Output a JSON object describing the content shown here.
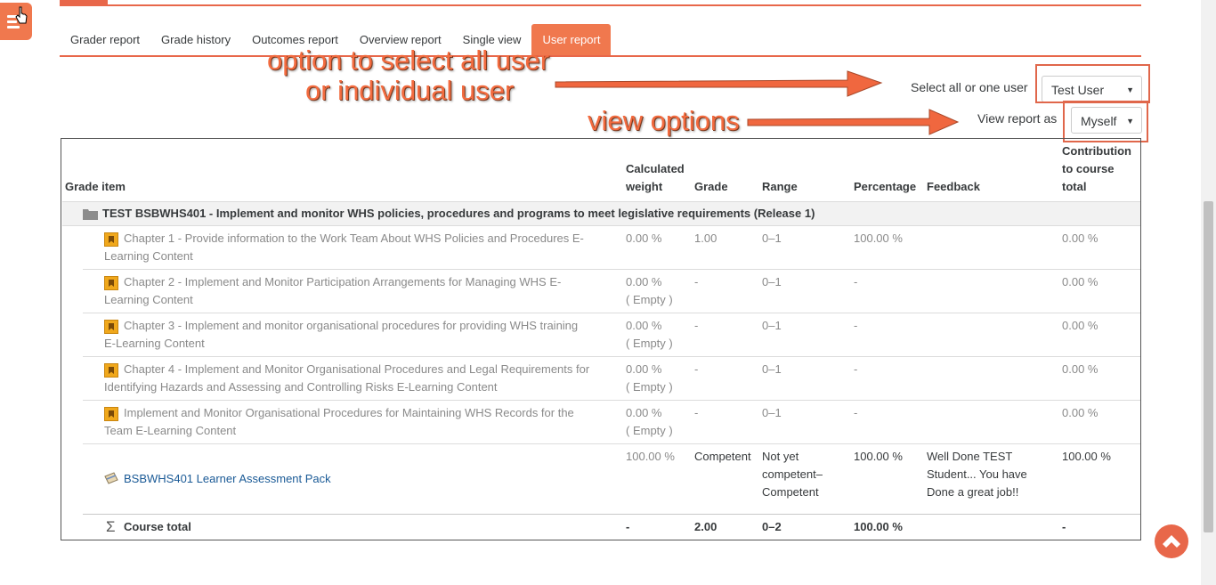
{
  "tabs": [
    "Grader report",
    "Grade history",
    "Outcomes report",
    "Overview report",
    "Single view",
    "User report"
  ],
  "active_tab": "User report",
  "annotations": {
    "line1": "option to select all user",
    "line2": "or individual user",
    "view_options": "view options"
  },
  "selectors": {
    "user_label": "Select all or one user",
    "user_value": "Test User",
    "view_label": "View report as",
    "view_value": "Myself"
  },
  "table": {
    "headers": {
      "grade_item": "Grade item",
      "calc_weight_1": "Calculated",
      "calc_weight_2": "weight",
      "grade": "Grade",
      "range": "Range",
      "percentage": "Percentage",
      "feedback": "Feedback",
      "contrib_1": "Contribution",
      "contrib_2": "to course",
      "contrib_3": "total"
    },
    "category": "TEST BSBWHS401 - Implement and monitor WHS policies, procedures and programs to meet legislative requirements (Release 1)",
    "rows": [
      {
        "item_1": "Chapter 1 - Provide information to the Work Team About WHS Policies and Procedures E-",
        "item_2": "Learning Content",
        "weight": "0.00 %",
        "weight_2": "",
        "grade": "1.00",
        "range": "0–1",
        "percentage": "100.00 %",
        "contrib": "0.00 %"
      },
      {
        "item_1": "Chapter 2 - Implement and Monitor Participation Arrangements for Managing WHS E-",
        "item_2": "Learning Content",
        "weight": "0.00 %",
        "weight_2": "( Empty )",
        "grade": "-",
        "range": "0–1",
        "percentage": "-",
        "contrib": "0.00 %"
      },
      {
        "item_1": "Chapter 3 - Implement and monitor organisational procedures for providing WHS training",
        "item_2": "E-Learning Content",
        "weight": "0.00 %",
        "weight_2": "( Empty )",
        "grade": "-",
        "range": "0–1",
        "percentage": "-",
        "contrib": "0.00 %"
      },
      {
        "item_1": "Chapter 4 - Implement and Monitor Organisational Procedures and Legal Requirements for",
        "item_2": "Identifying Hazards and Assessing and Controlling Risks E-Learning Content",
        "weight": "0.00 %",
        "weight_2": "( Empty )",
        "grade": "-",
        "range": "0–1",
        "percentage": "-",
        "contrib": "0.00 %"
      },
      {
        "item_1": "Implement and Monitor Organisational Procedures for Maintaining WHS Records for the",
        "item_2": "Team E-Learning Content",
        "weight": "0.00 %",
        "weight_2": "( Empty )",
        "grade": "-",
        "range": "0–1",
        "percentage": "-",
        "contrib": "0.00 %"
      }
    ],
    "assessment": {
      "item": "BSBWHS401 Learner Assessment Pack",
      "weight": "100.00 %",
      "grade": "Competent",
      "range_1": "Not yet",
      "range_2": "competent–",
      "range_3": "Competent",
      "percentage": "100.00 %",
      "feedback_1": "Well Done TEST",
      "feedback_2": "Student... You have",
      "feedback_3": "Done a great job!!",
      "contrib": "100.00 %"
    },
    "total": {
      "label": "Course total",
      "weight": "-",
      "grade": "2.00",
      "range": "0–2",
      "percentage": "100.00 %",
      "contrib": "-"
    }
  },
  "colors": {
    "accent": "#f0784e",
    "annotation": "#f26b3f",
    "link": "#1a5a96"
  },
  "icons": [
    "menu-icon",
    "hand-cursor-icon",
    "folder-icon",
    "quiz-icon",
    "assignment-icon",
    "sigma-icon",
    "chevron-up-icon"
  ]
}
